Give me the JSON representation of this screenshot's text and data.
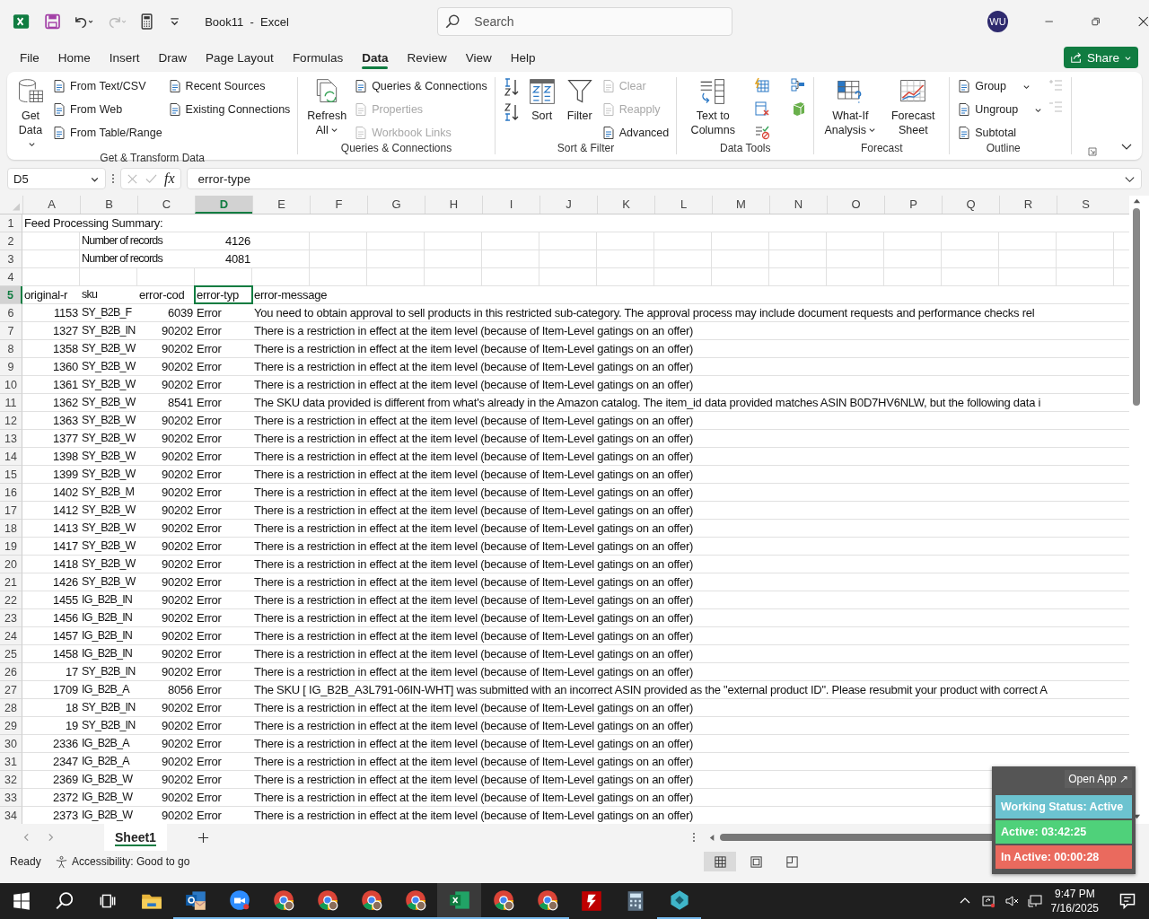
{
  "title_bar": {
    "title": "Book11  -  Excel",
    "search_placeholder": "Search",
    "avatar_initials": "WU"
  },
  "menu": {
    "tabs": [
      {
        "label": "File",
        "selected": false
      },
      {
        "label": "Home",
        "selected": false
      },
      {
        "label": "Insert",
        "selected": false
      },
      {
        "label": "Draw",
        "selected": false
      },
      {
        "label": "Page Layout",
        "selected": false
      },
      {
        "label": "Formulas",
        "selected": false
      },
      {
        "label": "Data",
        "selected": true
      },
      {
        "label": "Review",
        "selected": false
      },
      {
        "label": "View",
        "selected": false
      },
      {
        "label": "Help",
        "selected": false
      }
    ],
    "share": "Share"
  },
  "ribbon": {
    "groups": [
      {
        "label": "Get & Transform Data",
        "items": [
          {
            "label": "Get Data",
            "kind": "large",
            "dropdown": true,
            "disabled": false
          },
          {
            "label": "From Text/CSV",
            "kind": "small",
            "dropdown": false,
            "disabled": false
          },
          {
            "label": "From Web",
            "kind": "small",
            "dropdown": false,
            "disabled": false
          },
          {
            "label": "From Table/Range",
            "kind": "small",
            "dropdown": false,
            "disabled": false
          },
          {
            "label": "Recent Sources",
            "kind": "small",
            "dropdown": false,
            "disabled": false
          },
          {
            "label": "Existing Connections",
            "kind": "small",
            "dropdown": false,
            "disabled": false
          }
        ]
      },
      {
        "label": "Queries & Connections",
        "items": [
          {
            "label": "Refresh All",
            "kind": "large",
            "dropdown": true,
            "disabled": false
          },
          {
            "label": "Queries & Connections",
            "kind": "small",
            "dropdown": false,
            "disabled": false
          },
          {
            "label": "Properties",
            "kind": "small",
            "dropdown": false,
            "disabled": true
          },
          {
            "label": "Workbook Links",
            "kind": "small",
            "dropdown": false,
            "disabled": true
          }
        ]
      },
      {
        "label": "Sort & Filter",
        "items": [
          {
            "label": "Sort",
            "kind": "large",
            "dropdown": false,
            "disabled": false
          },
          {
            "label": "Filter",
            "kind": "large",
            "dropdown": false,
            "disabled": false
          },
          {
            "label": "Clear",
            "kind": "small",
            "dropdown": false,
            "disabled": true
          },
          {
            "label": "Reapply",
            "kind": "small",
            "dropdown": false,
            "disabled": true
          },
          {
            "label": "Advanced",
            "kind": "small",
            "dropdown": false,
            "disabled": false
          }
        ]
      },
      {
        "label": "Data Tools",
        "items": [
          {
            "label": "Text to Columns",
            "kind": "large",
            "dropdown": false,
            "disabled": false
          }
        ]
      },
      {
        "label": "Forecast",
        "items": [
          {
            "label": "What-If Analysis",
            "kind": "large",
            "dropdown": true,
            "disabled": false
          },
          {
            "label": "Forecast Sheet",
            "kind": "large",
            "dropdown": false,
            "disabled": false
          }
        ]
      },
      {
        "label": "Outline",
        "items": [
          {
            "label": "Group",
            "kind": "small",
            "dropdown": true,
            "disabled": false
          },
          {
            "label": "Ungroup",
            "kind": "small",
            "dropdown": true,
            "disabled": false
          },
          {
            "label": "Subtotal",
            "kind": "small",
            "dropdown": false,
            "disabled": false
          }
        ]
      }
    ]
  },
  "formula_bar": {
    "name_box": "D5",
    "function_symbol": "fx",
    "formula": "error-type"
  },
  "sheet": {
    "columns": [
      {
        "letter": "A",
        "selected": false
      },
      {
        "letter": "B",
        "selected": false
      },
      {
        "letter": "C",
        "selected": false
      },
      {
        "letter": "D",
        "selected": true
      },
      {
        "letter": "E",
        "selected": false
      },
      {
        "letter": "F",
        "selected": false
      },
      {
        "letter": "G",
        "selected": false
      },
      {
        "letter": "H",
        "selected": false
      },
      {
        "letter": "I",
        "selected": false
      },
      {
        "letter": "J",
        "selected": false
      },
      {
        "letter": "K",
        "selected": false
      },
      {
        "letter": "L",
        "selected": false
      },
      {
        "letter": "M",
        "selected": false
      },
      {
        "letter": "N",
        "selected": false
      },
      {
        "letter": "O",
        "selected": false
      },
      {
        "letter": "P",
        "selected": false
      },
      {
        "letter": "Q",
        "selected": false
      },
      {
        "letter": "R",
        "selected": false
      },
      {
        "letter": "S",
        "selected": false
      }
    ],
    "rows": [
      {
        "number": "1",
        "kind": "title",
        "selected": false,
        "cells": [
          "Feed Processing Summary:",
          null,
          null,
          null,
          null
        ]
      },
      {
        "number": "2",
        "kind": "summary",
        "selected": false,
        "cells": [
          null,
          "Number of records",
          null,
          "4126",
          null
        ]
      },
      {
        "number": "3",
        "kind": "summary",
        "selected": false,
        "cells": [
          null,
          "Number of records",
          null,
          "4081",
          null
        ]
      },
      {
        "number": "4",
        "kind": "blank",
        "selected": false,
        "cells": [
          null,
          null,
          null,
          null,
          null
        ]
      },
      {
        "number": "5",
        "kind": "header",
        "selected": true,
        "cells": [
          "original-r",
          "sku",
          "error-cod",
          "error-typ",
          "error-message"
        ]
      },
      {
        "number": "6",
        "kind": "record",
        "selected": false,
        "cells": [
          "1153",
          "SY_B2B_F",
          "6039",
          "Error",
          "You need to obtain approval to sell products in this restricted sub-category. The approval process may include document requests and performance checks rel"
        ]
      },
      {
        "number": "7",
        "kind": "record",
        "selected": false,
        "cells": [
          "1327",
          "SY_B2B_IN",
          "90202",
          "Error",
          "There is a restriction in effect at the item level (because of Item-Level gatings on an offer)"
        ]
      },
      {
        "number": "8",
        "kind": "record",
        "selected": false,
        "cells": [
          "1358",
          "SY_B2B_W",
          "90202",
          "Error",
          "There is a restriction in effect at the item level (because of Item-Level gatings on an offer)"
        ]
      },
      {
        "number": "9",
        "kind": "record",
        "selected": false,
        "cells": [
          "1360",
          "SY_B2B_W",
          "90202",
          "Error",
          "There is a restriction in effect at the item level (because of Item-Level gatings on an offer)"
        ]
      },
      {
        "number": "10",
        "kind": "record",
        "selected": false,
        "cells": [
          "1361",
          "SY_B2B_W",
          "90202",
          "Error",
          "There is a restriction in effect at the item level (because of Item-Level gatings on an offer)"
        ]
      },
      {
        "number": "11",
        "kind": "record",
        "selected": false,
        "cells": [
          "1362",
          "SY_B2B_W",
          "8541",
          "Error",
          "The SKU data provided is different from what's already in the Amazon catalog. The item_id data provided matches ASIN B0D7HV6NLW, but the following data i"
        ]
      },
      {
        "number": "12",
        "kind": "record",
        "selected": false,
        "cells": [
          "1363",
          "SY_B2B_W",
          "90202",
          "Error",
          "There is a restriction in effect at the item level (because of Item-Level gatings on an offer)"
        ]
      },
      {
        "number": "13",
        "kind": "record",
        "selected": false,
        "cells": [
          "1377",
          "SY_B2B_W",
          "90202",
          "Error",
          "There is a restriction in effect at the item level (because of Item-Level gatings on an offer)"
        ]
      },
      {
        "number": "14",
        "kind": "record",
        "selected": false,
        "cells": [
          "1398",
          "SY_B2B_W",
          "90202",
          "Error",
          "There is a restriction in effect at the item level (because of Item-Level gatings on an offer)"
        ]
      },
      {
        "number": "15",
        "kind": "record",
        "selected": false,
        "cells": [
          "1399",
          "SY_B2B_W",
          "90202",
          "Error",
          "There is a restriction in effect at the item level (because of Item-Level gatings on an offer)"
        ]
      },
      {
        "number": "16",
        "kind": "record",
        "selected": false,
        "cells": [
          "1402",
          "SY_B2B_M",
          "90202",
          "Error",
          "There is a restriction in effect at the item level (because of Item-Level gatings on an offer)"
        ]
      },
      {
        "number": "17",
        "kind": "record",
        "selected": false,
        "cells": [
          "1412",
          "SY_B2B_W",
          "90202",
          "Error",
          "There is a restriction in effect at the item level (because of Item-Level gatings on an offer)"
        ]
      },
      {
        "number": "18",
        "kind": "record",
        "selected": false,
        "cells": [
          "1413",
          "SY_B2B_W",
          "90202",
          "Error",
          "There is a restriction in effect at the item level (because of Item-Level gatings on an offer)"
        ]
      },
      {
        "number": "19",
        "kind": "record",
        "selected": false,
        "cells": [
          "1417",
          "SY_B2B_W",
          "90202",
          "Error",
          "There is a restriction in effect at the item level (because of Item-Level gatings on an offer)"
        ]
      },
      {
        "number": "20",
        "kind": "record",
        "selected": false,
        "cells": [
          "1418",
          "SY_B2B_W",
          "90202",
          "Error",
          "There is a restriction in effect at the item level (because of Item-Level gatings on an offer)"
        ]
      },
      {
        "number": "21",
        "kind": "record",
        "selected": false,
        "cells": [
          "1426",
          "SY_B2B_W",
          "90202",
          "Error",
          "There is a restriction in effect at the item level (because of Item-Level gatings on an offer)"
        ]
      },
      {
        "number": "22",
        "kind": "record",
        "selected": false,
        "cells": [
          "1455",
          "IG_B2B_IN",
          "90202",
          "Error",
          "There is a restriction in effect at the item level (because of Item-Level gatings on an offer)"
        ]
      },
      {
        "number": "23",
        "kind": "record",
        "selected": false,
        "cells": [
          "1456",
          "IG_B2B_IN",
          "90202",
          "Error",
          "There is a restriction in effect at the item level (because of Item-Level gatings on an offer)"
        ]
      },
      {
        "number": "24",
        "kind": "record",
        "selected": false,
        "cells": [
          "1457",
          "IG_B2B_IN",
          "90202",
          "Error",
          "There is a restriction in effect at the item level (because of Item-Level gatings on an offer)"
        ]
      },
      {
        "number": "25",
        "kind": "record",
        "selected": false,
        "cells": [
          "1458",
          "IG_B2B_IN",
          "90202",
          "Error",
          "There is a restriction in effect at the item level (because of Item-Level gatings on an offer)"
        ]
      },
      {
        "number": "26",
        "kind": "record",
        "selected": false,
        "cells": [
          "17",
          "SY_B2B_IN",
          "90202",
          "Error",
          "There is a restriction in effect at the item level (because of Item-Level gatings on an offer)"
        ]
      },
      {
        "number": "27",
        "kind": "record",
        "selected": false,
        "cells": [
          "1709",
          "IG_B2B_A",
          "8056",
          "Error",
          "The SKU [ IG_B2B_A3L791-06IN-WHT] was submitted with an incorrect ASIN provided as the \"external product ID\". Please resubmit your product with correct A"
        ]
      },
      {
        "number": "28",
        "kind": "record",
        "selected": false,
        "cells": [
          "18",
          "SY_B2B_IN",
          "90202",
          "Error",
          "There is a restriction in effect at the item level (because of Item-Level gatings on an offer)"
        ]
      },
      {
        "number": "29",
        "kind": "record",
        "selected": false,
        "cells": [
          "19",
          "SY_B2B_IN",
          "90202",
          "Error",
          "There is a restriction in effect at the item level (because of Item-Level gatings on an offer)"
        ]
      },
      {
        "number": "30",
        "kind": "record",
        "selected": false,
        "cells": [
          "2336",
          "IG_B2B_A",
          "90202",
          "Error",
          "There is a restriction in effect at the item level (because of Item-Level gatings on an offer)"
        ]
      },
      {
        "number": "31",
        "kind": "record",
        "selected": false,
        "cells": [
          "2347",
          "IG_B2B_A",
          "90202",
          "Error",
          "There is a restriction in effect at the item level (because of Item-Level gatings on an offer)"
        ]
      },
      {
        "number": "32",
        "kind": "record",
        "selected": false,
        "cells": [
          "2369",
          "IG_B2B_W",
          "90202",
          "Error",
          "There is a restriction in effect at the item level (because of Item-Level gatings on an offer)"
        ]
      },
      {
        "number": "33",
        "kind": "record",
        "selected": false,
        "cells": [
          "2372",
          "IG_B2B_W",
          "90202",
          "Error",
          "There is a restriction in effect at the item level (because of Item-Level gatings on an offer)"
        ]
      },
      {
        "number": "34",
        "kind": "record",
        "selected": false,
        "cells": [
          "2373",
          "IG_B2B_W",
          "90202",
          "Error",
          "There is a restriction in effect at the item level (because of Item-Level gatings on an offer)"
        ]
      }
    ]
  },
  "sheet_tabs": [
    {
      "label": "Sheet1",
      "selected": true
    }
  ],
  "status_bar": {
    "status": "Ready",
    "accessibility": "Accessibility: Good to go",
    "views": [
      {
        "selected": true
      },
      {
        "selected": false
      },
      {
        "selected": false
      }
    ]
  },
  "taskbar": {
    "apps": [
      {
        "running": false,
        "active": false
      },
      {
        "running": true,
        "active": false
      },
      {
        "running": true,
        "active": false
      },
      {
        "running": true,
        "active": false
      },
      {
        "running": true,
        "active": false
      },
      {
        "running": true,
        "active": false
      },
      {
        "running": true,
        "active": false
      },
      {
        "running": true,
        "active": true
      },
      {
        "running": true,
        "active": false
      },
      {
        "running": true,
        "active": false
      },
      {
        "running": false,
        "active": false
      },
      {
        "running": false,
        "active": false
      },
      {
        "running": true,
        "active": false
      }
    ],
    "time": "9:47 PM",
    "date": "7/16/2025"
  },
  "tracker_widget": {
    "open_app": "Open App ↗",
    "statuses": [
      {
        "text": "Working Status: Active",
        "color": "#6cc3d0"
      },
      {
        "text": "Active: 03:42:25",
        "color": "#4fd17a"
      },
      {
        "text": "In Active: 00:00:28",
        "color": "#ea6a5e"
      }
    ]
  }
}
